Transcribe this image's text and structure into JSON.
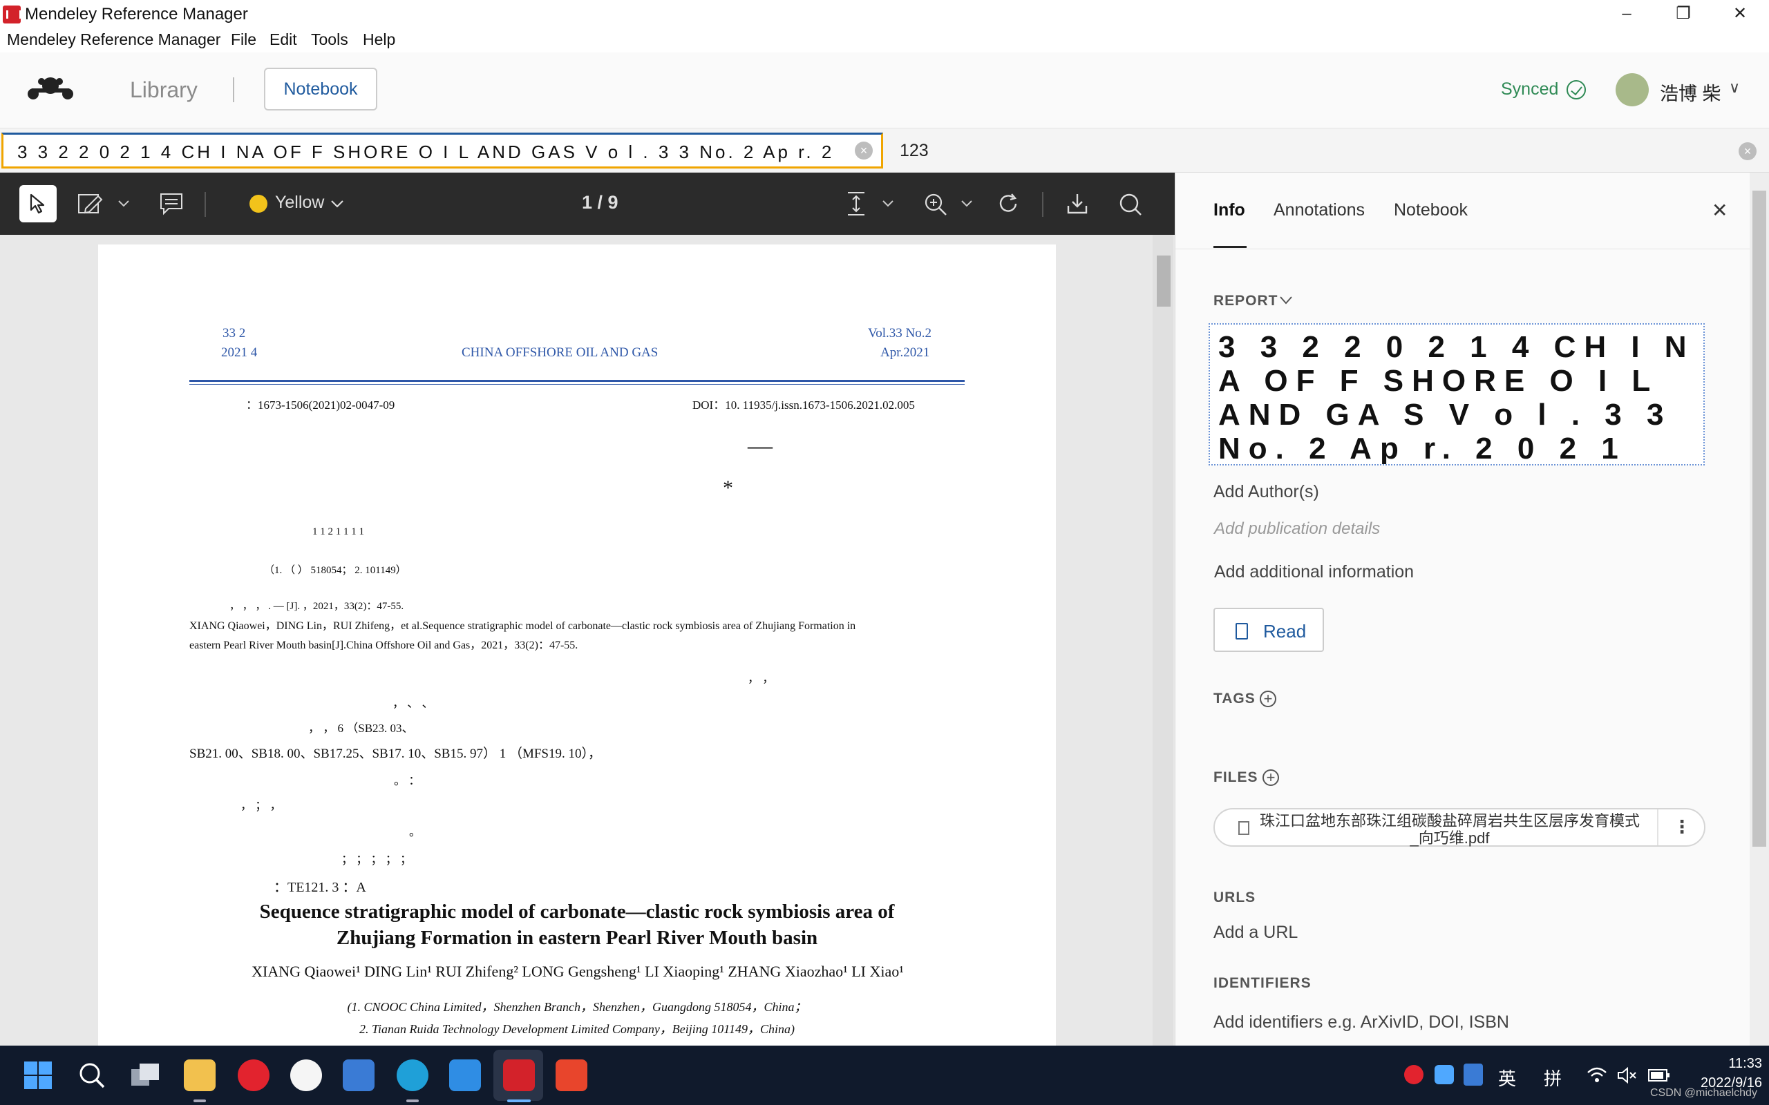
{
  "window": {
    "title": "Mendeley Reference Manager",
    "minimize": "–",
    "restore": "❐",
    "close": "✕"
  },
  "menu": {
    "items": [
      "Mendeley Reference Manager",
      "File",
      "Edit",
      "Tools",
      "Help"
    ]
  },
  "header": {
    "library_label": "Library",
    "notebook_label": "Notebook",
    "sync_status": "Synced",
    "user_name": "浩博 柴",
    "user_chevron": "∨"
  },
  "tabs": {
    "doc_tab_label": "3 3 2 2 0 2 1 4 CH I NA OF F SHORE O I L AND GAS V o l . 3 3 No. 2 Ap r. 2 0 2 1",
    "second_tab_label": "123",
    "close_glyph": "×"
  },
  "pdf_toolbar": {
    "highlight_color": "Yellow",
    "highlight_color_hex": "#f2c31b",
    "page_indicator": "1 / 9"
  },
  "pdf_page": {
    "header_left_1": "33          2",
    "header_left_2": "2021      4",
    "header_center": "CHINA OFFSHORE OIL AND GAS",
    "header_right_1": "Vol.33    No.2",
    "header_right_2": "Apr.2021",
    "issn": "：1673-1506(2021)02-0047-09",
    "doi": "DOI：10. 11935/j.issn.1673-1506.2021.02.005",
    "dash": "—",
    "star": "*",
    "superscripts": "1                        1                        2                        1                        1                        1                        1",
    "affil_line": "（1.             （       ）                                                      518054；  2.                                                  101149）",
    "cite_cn": "，      ，      ，   .                                              —                                    [J].                    ，2021，33(2)：47-55.",
    "cite_en_1": "XIANG Qiaowei，DING Lin，RUI Zhifeng，et al.Sequence stratigraphic model of carbonate—clastic rock symbiosis area of Zhujiang Formation in",
    "cite_en_2": "eastern Pearl River Mouth basin[J].China Offshore Oil and Gas，2021，33(2)：47-55.",
    "abs_1": "，                        ，",
    "abs_2": "，                                                                                      、                  、",
    "abs_3": "，                                                                                        ，              6                                         （SB23. 03、",
    "abs_4": "SB21. 00、SB18. 00、SB17.25、SB17. 10、SB15. 97）   1                              （MFS19. 10），",
    "abs_5": "。                                                                                                                            ：",
    "abs_6": "，                                                                                                  ；                                ，",
    "abs_7": "。",
    "keywords": "；             ；                    ；             ；                 ；",
    "clc": "：TE121. 3                                    ：A",
    "title_en_1": "Sequence stratigraphic model of carbonate—clastic rock symbiosis area of",
    "title_en_2": "Zhujiang Formation in eastern Pearl River Mouth basin",
    "authors_en": "XIANG Qiaowei¹   DING Lin¹   RUI Zhifeng²   LONG Gengsheng¹   LI Xiaoping¹   ZHANG Xiaozhao¹   LI Xiao¹",
    "aff_en_1": "(1. CNOOC China Limited，Shenzhen Branch，Shenzhen，Guangdong 518054，China；",
    "aff_en_2": "2. Tianan Ruida Technology Development Limited Company，Beijing 101149，China)"
  },
  "info_panel": {
    "tabs": [
      "Info",
      "Annotations",
      "Notebook"
    ],
    "close_glyph": "✕",
    "doc_type": "REPORT",
    "title_text": "3 3 2 2 0 2 1 4 CH I NA OF F SHORE O I L AND GA S V o l . 3 3 No. 2 Ap r. 2 0 2 1",
    "add_authors": "Add Author(s)",
    "add_publication": "Add publication details",
    "add_additional": "Add additional information",
    "read_label": "Read",
    "tags_label": "TAGS",
    "files_label": "FILES",
    "file_name": "珠江口盆地东部珠江组碳酸盐碎屑岩共生区层序发育模式_向巧维.pdf",
    "file_more": "⋮",
    "urls_label": "URLS",
    "add_url": "Add a URL",
    "identifiers_label": "IDENTIFIERS",
    "add_identifiers": "Add identifiers e.g. ArXivID, DOI, ISBN"
  },
  "taskbar": {
    "tray_lang_1": "英",
    "tray_lang_2": "拼",
    "time": "11:33",
    "date": "2022/9/16",
    "watermark": "CSDN @michaelchdy"
  }
}
